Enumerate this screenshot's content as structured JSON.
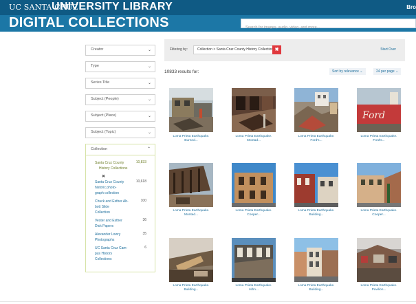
{
  "header": {
    "brand_ucsc": "UC SANTA CRUZ",
    "brand_library": "UNIVERSITY LIBRARY",
    "browse_link": "Bro",
    "title": "DIGITAL COLLECTIONS",
    "search_placeholder": "Search for images, audio, video, and more..."
  },
  "facets": [
    {
      "label": "Creator"
    },
    {
      "label": "Type"
    },
    {
      "label": "Series Title"
    },
    {
      "label": "Subject (People)"
    },
    {
      "label": "Subject (Place)"
    },
    {
      "label": "Subject (Topic)"
    }
  ],
  "collection_facet": {
    "label": "Collection",
    "items": [
      {
        "lines": [
          "Santa Cruz County",
          "History Collections"
        ],
        "count": "10,833",
        "active": true
      },
      {
        "lines": [
          "Santa Cruz County",
          "historic photo-",
          "graph collection"
        ],
        "count": "10,618",
        "active": false
      },
      {
        "lines": [
          "Chuck and Esther Ab-",
          "bott Slide",
          "Collection"
        ],
        "count": "100",
        "active": false
      },
      {
        "lines": [
          "Vester and Esther",
          "Dick Papers"
        ],
        "count": "36",
        "active": false
      },
      {
        "lines": [
          "Alexander Lowry",
          "Photographs"
        ],
        "count": "35",
        "active": false
      },
      {
        "lines": [
          "UC Santa Cruz Cam-",
          "pus History",
          "Collections"
        ],
        "count": "6",
        "active": false
      }
    ],
    "remove_icon": "✖"
  },
  "filter": {
    "label": "Filtering by:",
    "pill": "Collection > Santa Cruz County History Collections",
    "remove": "✖",
    "start_over": "Start Over"
  },
  "results": {
    "count_text": "10833 results for:",
    "sort_label": "Sort by relevance ⌄",
    "perpage_label": "24 per page ⌄"
  },
  "items": [
    {
      "l1": "Loma Prieta Earthquake.",
      "l2": "Burned..."
    },
    {
      "l1": "Loma Prieta Earthquake.",
      "l2": "Montad..."
    },
    {
      "l1": "Loma Prieta Earthquake.",
      "l2": "Ford's..."
    },
    {
      "l1": "Loma Prieta Earthquake.",
      "l2": "Ford's..."
    },
    {
      "l1": "Loma Prieta Earthquake.",
      "l2": "Montad..."
    },
    {
      "l1": "Loma Prieta Earthquake.",
      "l2": "Cooper..."
    },
    {
      "l1": "Loma Prieta Earthquake.",
      "l2": "Building..."
    },
    {
      "l1": "Loma Prieta Earthquake.",
      "l2": "Cooper..."
    },
    {
      "l1": "Loma Prieta Earthquake.",
      "l2": "Building..."
    },
    {
      "l1": "Loma Prieta Earthquake.",
      "l2": "Hihn..."
    },
    {
      "l1": "Loma Prieta Earthquake.",
      "l2": "Building..."
    },
    {
      "l1": "Loma Prieta Earthquake.",
      "l2": "Pavilion..."
    }
  ],
  "colors": {
    "topbar": "#0f5a84",
    "header": "#1c77a6",
    "link": "#1e6f9c",
    "active": "#6f7f2a",
    "remove_red": "#e0393e"
  }
}
